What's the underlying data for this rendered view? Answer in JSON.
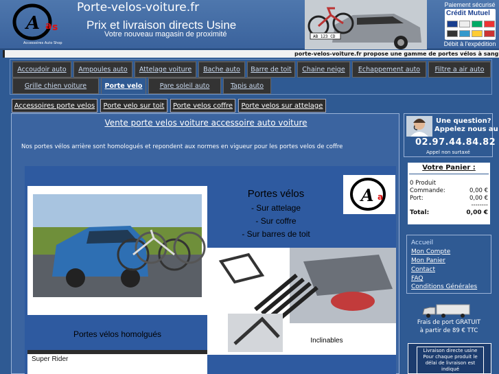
{
  "header": {
    "site_name": "Porte-velos-voiture.fr",
    "slogan": "Prix et livraison directs Usine",
    "subslogan": "Votre nouveau magasin de proximité",
    "logo_text": "Accessoires Auto Shop",
    "payment_top": "Paiement sécurisé",
    "payment_bottom": "Débit à l'expédition",
    "payment_brand": "Crédit Mutuel",
    "plate_text": "AB 123 CD"
  },
  "ticker": {
    "text": "porte-velos-voiture.fr propose une gamme de portes vélos à sangles, porte"
  },
  "nav": {
    "row1": [
      "Accoudoir auto",
      "Ampoules auto",
      "Attelage voiture",
      "Bache auto",
      "Barre de toit",
      "Chaine neige",
      "Echappement auto",
      "Filtre a air auto"
    ],
    "row2": [
      "Grille chien voiture",
      "Porte velo",
      "Pare soleil auto",
      "Tapis auto"
    ],
    "active": "Porte velo"
  },
  "subnav": [
    "Accessoires porte velos",
    "Porte velo sur toit",
    "Porte velos coffre",
    "Porte velos sur attelage"
  ],
  "main": {
    "title": "Vente porte velos voiture accessoire auto voiture",
    "intro": "Nos portes vélos arrière sont homologués et repondent aux normes en vigueur pour les portes velos de coffre",
    "promo": {
      "heading": "Portes vélos",
      "line1": "- Sur attelage",
      "line2": "- Sur coffre",
      "line3": "- Sur barres de toit",
      "caption": "Portes vélos homolgués",
      "super_rider": "Super Rider",
      "inclinables": "Inclinables"
    }
  },
  "sidebar": {
    "contact": {
      "question": "Une question?",
      "call": "Appelez nous au",
      "phone": "02.97.44.84.82",
      "note": "Appel non surtaxé"
    },
    "cart": {
      "title": "Votre Panier :",
      "product_count": "0 Produit",
      "order_label": "Commande:",
      "order_value": "0,00 €",
      "port_label": "Port:",
      "port_value": "0,00 €",
      "separator": "--------",
      "total_label": "Total:",
      "total_value": "0,00 €"
    },
    "menu": [
      "Accueil",
      "Mon Compte",
      "Mon Panier",
      "Contact",
      "FAQ",
      "Conditions Générales"
    ],
    "shipping": {
      "line1": "Frais de port GRATUIT",
      "line2": "à partir de 89 € TTC"
    },
    "delivery": {
      "line1": "Livraison directe usine",
      "line2": "Pour chaque produit le",
      "line3": "délai de livraison est",
      "line4": "indiqué"
    }
  },
  "colors": {
    "background": "#2f5a93",
    "nav_tab": "#333333",
    "link": "#ffffff"
  }
}
